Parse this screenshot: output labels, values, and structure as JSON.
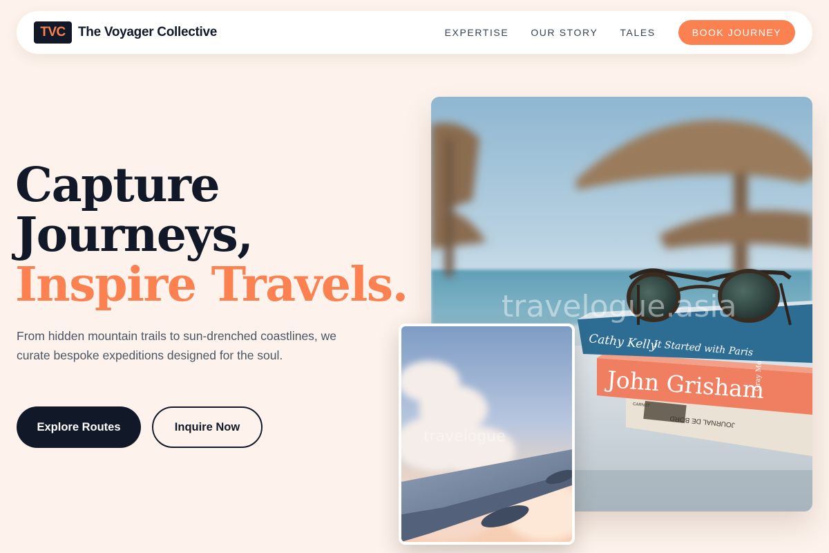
{
  "nav": {
    "logo_text": "TVC",
    "brand_name": "The Voyager Collective",
    "links": [
      "EXPERTISE",
      "OUR STORY",
      "TALES"
    ],
    "cta": "BOOK JOURNEY"
  },
  "hero": {
    "headline_line1": "Capture",
    "headline_line2": "Journeys,",
    "headline_accent": "Inspire Travels.",
    "subtext": "From hidden mountain trails to sun-drenched coastlines, we curate bespoke expeditions designed for the soul.",
    "primary_button": "Explore Routes",
    "secondary_button": "Inquire Now"
  },
  "images": {
    "main": {
      "watermark": "travelogue.asia",
      "book_top_author": "Cathy Kelly",
      "book_top_title": "It Started with Paris",
      "book_middle_author": "John Grisham",
      "book_middle_spine": "Gray Mountain",
      "book_bottom_title": "JOURNAL DE BORD",
      "book_bottom_publisher": "CARNET"
    },
    "small": {
      "watermark": "travelogue"
    }
  },
  "colors": {
    "background": "#fdf3ec",
    "accent": "#fb8151",
    "dark": "#111827",
    "body_text": "#4b5563"
  }
}
